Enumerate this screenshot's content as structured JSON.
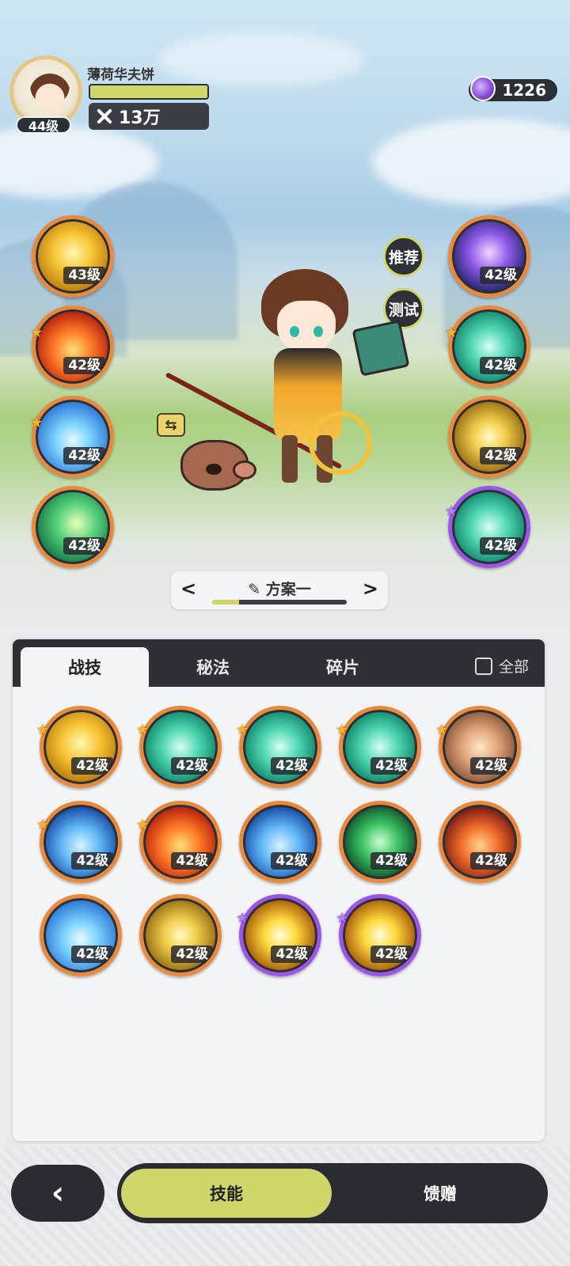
{
  "player": {
    "name": "薄荷华夫饼",
    "level": "44级",
    "power": "13万"
  },
  "currency": {
    "amount": "1226",
    "icon": "purple-gem-icon"
  },
  "side_buttons": {
    "recommend": "推荐",
    "test": "测试",
    "swap_icon": "⇆"
  },
  "left_skills": [
    {
      "level": "43级",
      "icon": "golden-lightning-icon",
      "star": false
    },
    {
      "level": "42级",
      "icon": "fire-burst-icon",
      "star": true
    },
    {
      "level": "42级",
      "icon": "ice-shard-icon",
      "star": true
    },
    {
      "level": "42级",
      "icon": "green-wind-icon",
      "star": false
    }
  ],
  "right_skills": [
    {
      "level": "42级",
      "icon": "void-portal-icon",
      "star": false,
      "frame": "orange"
    },
    {
      "level": "42级",
      "icon": "teal-clover-icon",
      "star": true,
      "frame": "orange"
    },
    {
      "level": "42级",
      "icon": "gold-burst-icon",
      "star": false,
      "frame": "orange"
    },
    {
      "level": "42级",
      "icon": "jade-ring-icon",
      "star": true,
      "frame": "purple"
    }
  ],
  "preset": {
    "label": "方案一",
    "progress": 0.2,
    "prev": "<",
    "next": ">"
  },
  "tabs": [
    "战技",
    "秘法",
    "碎片"
  ],
  "active_tab": "战技",
  "all_toggle": "全部",
  "skill_grid": [
    {
      "level": "42级",
      "icon": "golden-triangle-icon",
      "star": "gold",
      "frame": "orange"
    },
    {
      "level": "42级",
      "icon": "teal-slash-icon",
      "star": "gold",
      "frame": "orange"
    },
    {
      "level": "42级",
      "icon": "thorn-vine-icon",
      "star": "gold",
      "frame": "orange"
    },
    {
      "level": "42级",
      "icon": "water-vortex-icon",
      "star": "gold",
      "frame": "orange"
    },
    {
      "level": "42级",
      "icon": "card-burst-icon",
      "star": "gold",
      "frame": "orange"
    },
    {
      "level": "42级",
      "icon": "ice-crystal-icon",
      "star": "gold",
      "frame": "orange"
    },
    {
      "level": "42级",
      "icon": "fire-orb-icon",
      "star": "gold",
      "frame": "orange"
    },
    {
      "level": "42级",
      "icon": "blue-flame-icon",
      "star": "none",
      "frame": "orange"
    },
    {
      "level": "42级",
      "icon": "heal-cross-icon",
      "star": "none",
      "frame": "orange"
    },
    {
      "level": "42级",
      "icon": "fire-swirl-icon",
      "star": "none",
      "frame": "orange"
    },
    {
      "level": "42级",
      "icon": "ice-spikes-icon",
      "star": "none",
      "frame": "orange"
    },
    {
      "level": "42级",
      "icon": "sun-rise-icon",
      "star": "none",
      "frame": "orange"
    },
    {
      "level": "42级",
      "icon": "light-explosion-icon",
      "star": "purple",
      "frame": "purple"
    },
    {
      "level": "42级",
      "icon": "lightning-storm-icon",
      "star": "purple",
      "frame": "purple"
    }
  ],
  "bottom_nav": {
    "back": "‹",
    "items": [
      "技能",
      "馈赠"
    ],
    "active": "技能"
  }
}
